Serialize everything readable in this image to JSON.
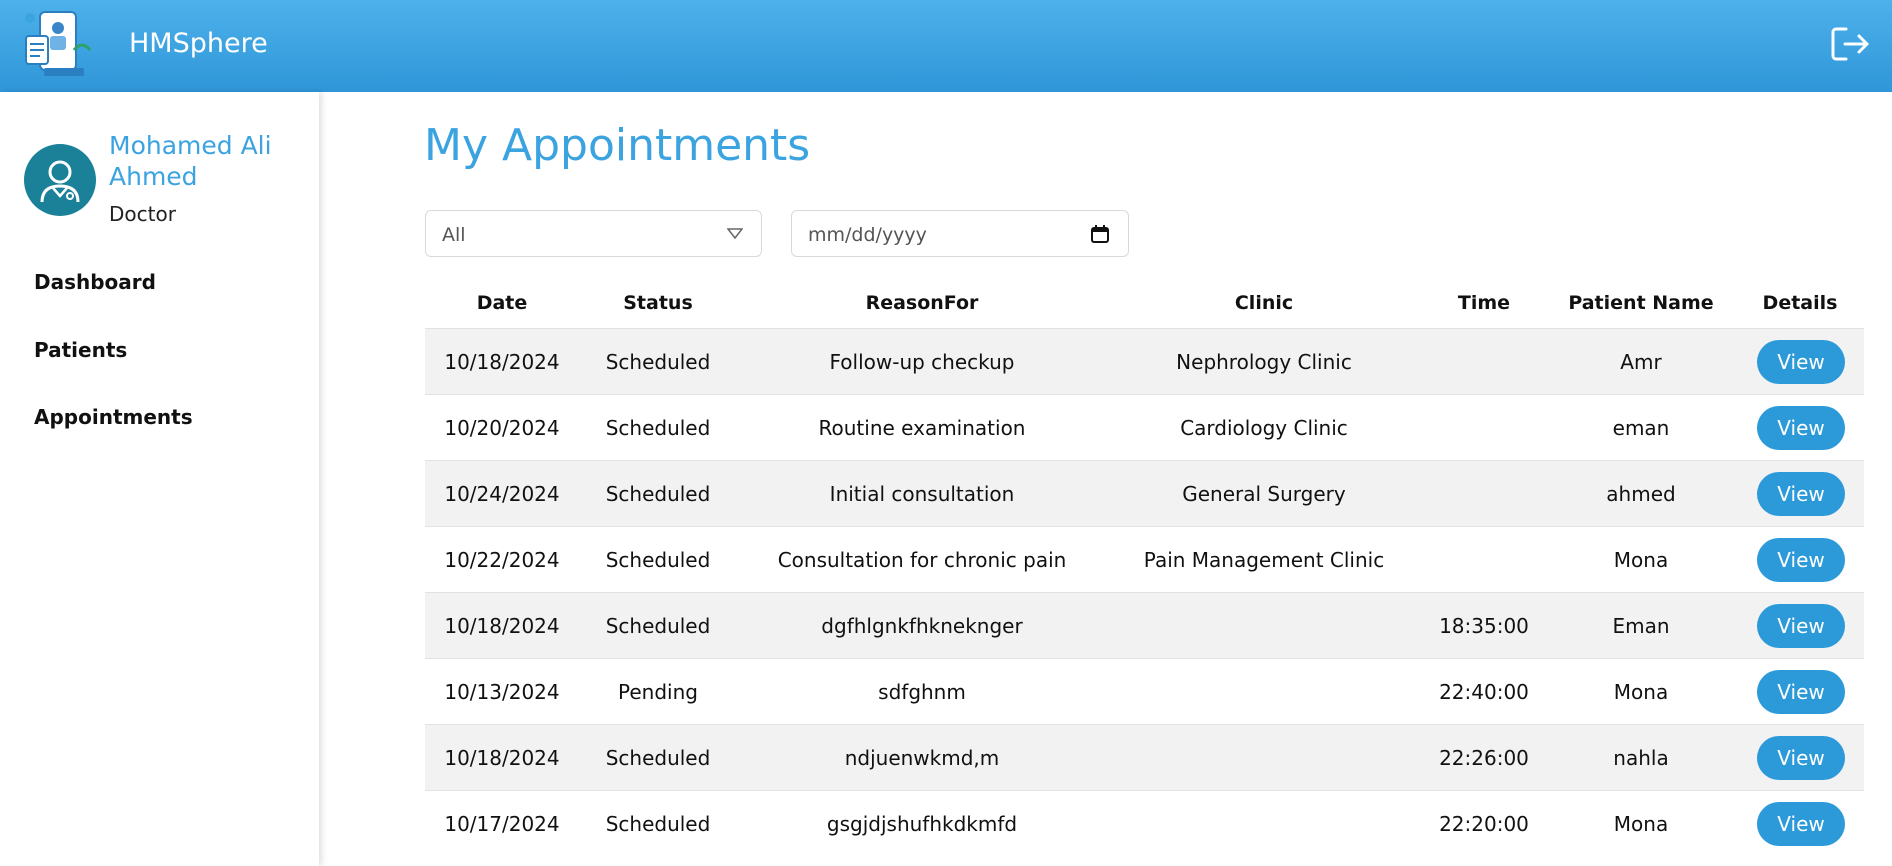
{
  "header": {
    "app_title": "HMSphere"
  },
  "profile": {
    "name": "Mohamed Ali Ahmed",
    "role": "Doctor"
  },
  "sidebar": {
    "items": [
      {
        "label": "Dashboard"
      },
      {
        "label": "Patients"
      },
      {
        "label": "Appointments"
      }
    ]
  },
  "page": {
    "title": "My Appointments"
  },
  "filters": {
    "status_value": "All",
    "date_placeholder": "mm/dd/yyyy"
  },
  "table": {
    "columns": [
      "Date",
      "Status",
      "ReasonFor",
      "Clinic",
      "Time",
      "Patient Name",
      "Details"
    ],
    "rows": [
      {
        "date": "10/18/2024",
        "status": "Scheduled",
        "reason": "Follow-up checkup",
        "clinic": "Nephrology Clinic",
        "time": "",
        "patient": "Amr",
        "action": "View"
      },
      {
        "date": "10/20/2024",
        "status": "Scheduled",
        "reason": "Routine examination",
        "clinic": "Cardiology Clinic",
        "time": "",
        "patient": "eman",
        "action": "View"
      },
      {
        "date": "10/24/2024",
        "status": "Scheduled",
        "reason": "Initial consultation",
        "clinic": "General Surgery",
        "time": "",
        "patient": "ahmed",
        "action": "View"
      },
      {
        "date": "10/22/2024",
        "status": "Scheduled",
        "reason": "Consultation for chronic pain",
        "clinic": "Pain Management Clinic",
        "time": "",
        "patient": "Mona",
        "action": "View"
      },
      {
        "date": "10/18/2024",
        "status": "Scheduled",
        "reason": "dgfhlgnkfhkneknger",
        "clinic": "",
        "time": "18:35:00",
        "patient": "Eman",
        "action": "View"
      },
      {
        "date": "10/13/2024",
        "status": "Pending",
        "reason": "sdfghnm",
        "clinic": "",
        "time": "22:40:00",
        "patient": "Mona",
        "action": "View"
      },
      {
        "date": "10/18/2024",
        "status": "Scheduled",
        "reason": "ndjuenwkmd,m",
        "clinic": "",
        "time": "22:26:00",
        "patient": "nahla",
        "action": "View"
      },
      {
        "date": "10/17/2024",
        "status": "Scheduled",
        "reason": "gsgjdjshufhkdkmfd",
        "clinic": "",
        "time": "22:20:00",
        "patient": "Mona",
        "action": "View"
      }
    ]
  },
  "icons": {
    "logo": "doctor-app-logo",
    "logout": "logout-icon",
    "avatar": "doctor-avatar-icon",
    "dropdown": "chevron-down-icon",
    "calendar": "calendar-icon"
  },
  "colors": {
    "header_bg": "#3ea5e3",
    "accent": "#3aa3e0",
    "button": "#2c9ad9",
    "avatar_bg": "#1b8199",
    "row_alt": "#f2f2f2"
  }
}
